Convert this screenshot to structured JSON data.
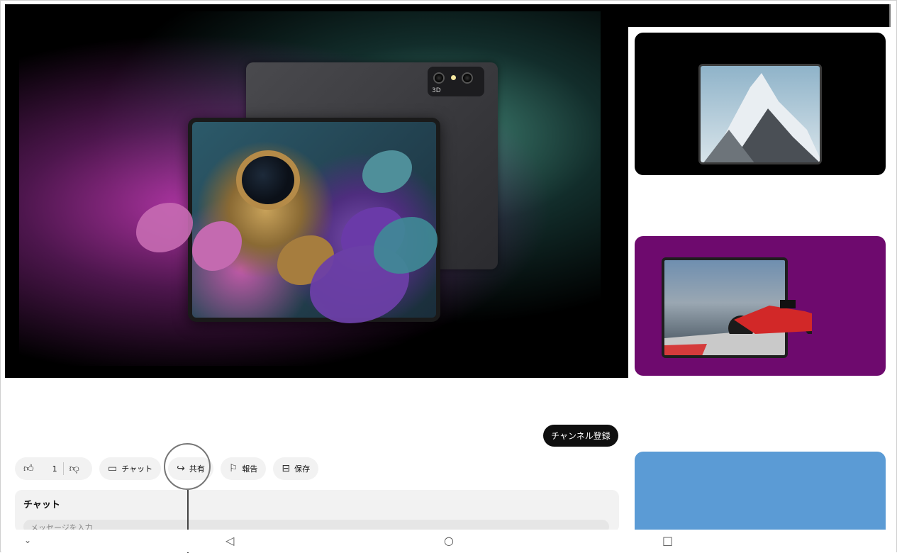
{
  "video": {
    "camera_label": "3D"
  },
  "actions": {
    "like_count": "1",
    "chat_label": "チャット",
    "share_label": "共有",
    "report_label": "報告",
    "save_label": "保存"
  },
  "channel": {
    "subscribe_label": "チャンネル登録"
  },
  "chat": {
    "title": "チャット",
    "placeholder": "メッセージを入力"
  },
  "icons": {
    "like": "thumbs-up-icon",
    "dislike": "thumbs-down-icon",
    "chat": "chat-icon",
    "share": "share-icon",
    "report": "flag-icon",
    "save": "save-icon",
    "nav_down": "chevron-down-icon",
    "nav_back": "back-triangle-icon",
    "nav_home": "home-circle-icon",
    "nav_recents": "recents-square-icon"
  },
  "colors": {
    "accent_purple": "#6e0a6e",
    "accent_blue": "#5b9bd5",
    "subscribe_bg": "#0f0f0f"
  }
}
